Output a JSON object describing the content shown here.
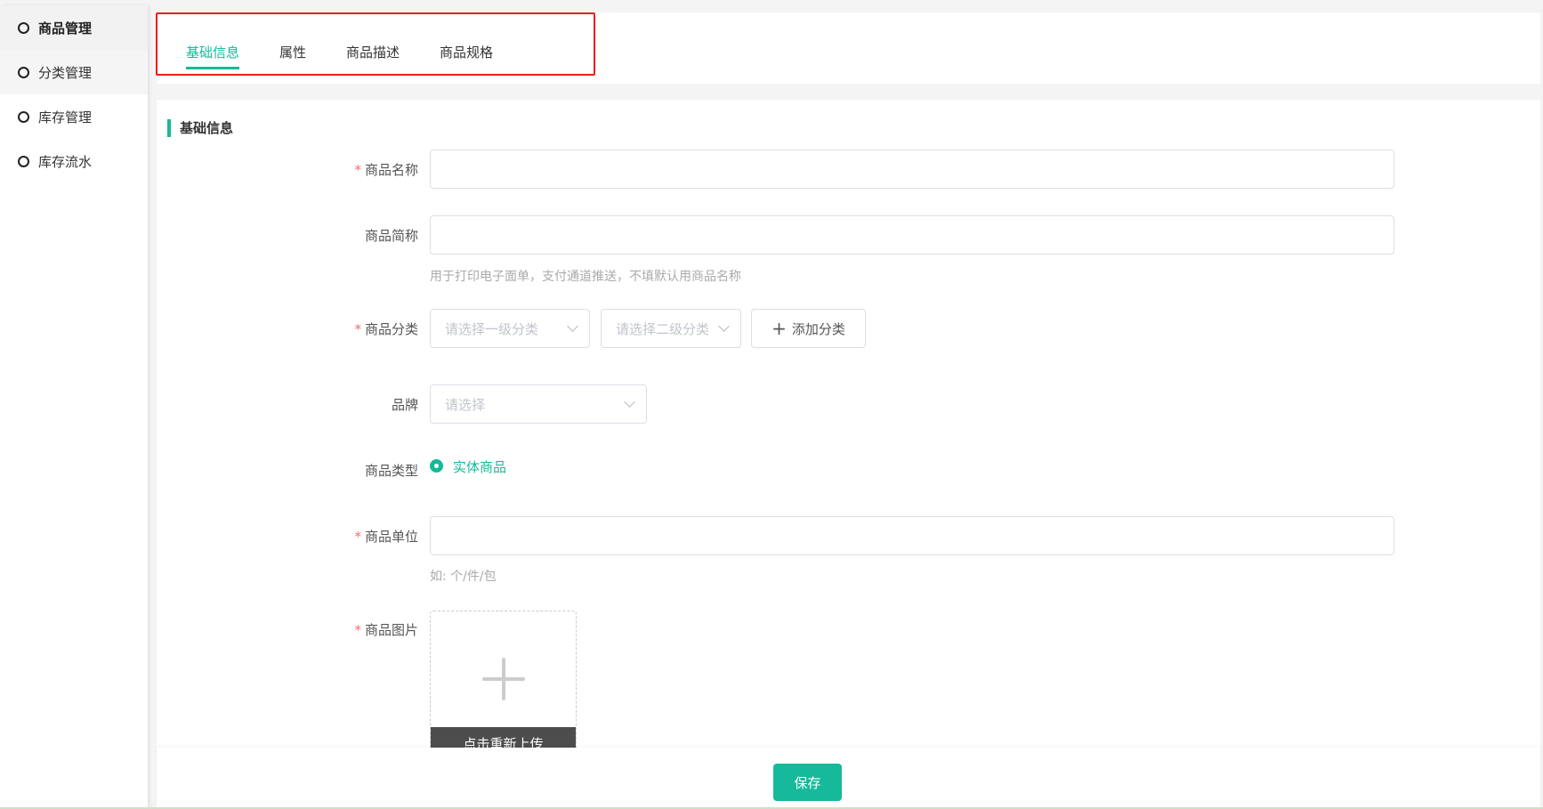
{
  "sidebar": {
    "items": [
      {
        "label": "商品管理"
      },
      {
        "label": "分类管理"
      },
      {
        "label": "库存管理"
      },
      {
        "label": "库存流水"
      }
    ]
  },
  "tabs": [
    {
      "label": "基础信息"
    },
    {
      "label": "属性"
    },
    {
      "label": "商品描述"
    },
    {
      "label": "商品规格"
    }
  ],
  "section": {
    "title": "基础信息"
  },
  "form": {
    "name": {
      "label": "商品名称",
      "value": ""
    },
    "short_name": {
      "label": "商品简称",
      "value": "",
      "hint": "用于打印电子面单，支付通道推送，不填默认用商品名称"
    },
    "category": {
      "label": "商品分类",
      "level1_placeholder": "请选择一级分类",
      "level2_placeholder": "请选择二级分类",
      "add_label": "添加分类"
    },
    "brand": {
      "label": "品牌",
      "placeholder": "请选择"
    },
    "type": {
      "label": "商品类型",
      "option": "实体商品"
    },
    "unit": {
      "label": "商品单位",
      "value": "",
      "hint": "如: 个/件/包"
    },
    "image": {
      "label": "商品图片",
      "reupload_label": "点击重新上传"
    }
  },
  "footer": {
    "save_label": "保存"
  },
  "colors": {
    "accent": "#16b99a",
    "required": "#f56c6c",
    "highlight": "#f21b1b"
  }
}
